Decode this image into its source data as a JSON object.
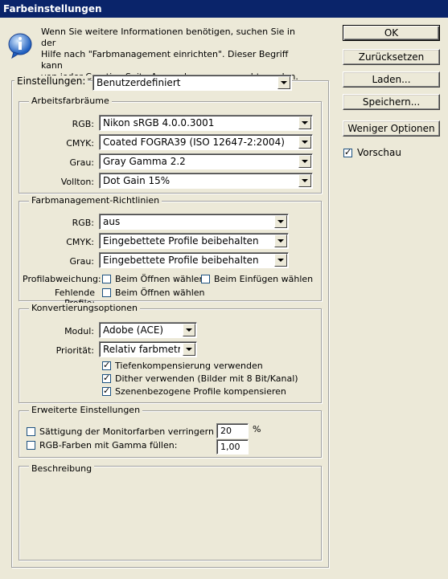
{
  "window": {
    "title": "Farbeinstellungen"
  },
  "info": {
    "text_line1": "Wenn Sie weitere Informationen benötigen, suchen Sie in der",
    "text_line2": "Hilfe nach \"Farbmanagement einrichten\". Dieser Begriff kann",
    "text_line3": "von jeder Creative Suite-Anwendung aus gesucht werden."
  },
  "buttons": {
    "ok": "OK",
    "reset": "Zurücksetzen",
    "load": "Laden...",
    "save": "Speichern...",
    "fewer_options": "Weniger Optionen"
  },
  "preview": {
    "label": "Vorschau",
    "checked": true
  },
  "settings": {
    "label": "Einstellungen:",
    "value": "Benutzerdefiniert"
  },
  "workspaces": {
    "legend": "Arbeitsfarbräume",
    "rgb_label": "RGB:",
    "rgb_value": "Nikon sRGB 4.0.0.3001",
    "cmyk_label": "CMYK:",
    "cmyk_value": "Coated FOGRA39 (ISO 12647-2:2004)",
    "gray_label": "Grau:",
    "gray_value": "Gray Gamma 2.2",
    "spot_label": "Vollton:",
    "spot_value": "Dot Gain 15%"
  },
  "policies": {
    "legend": "Farbmanagement-Richtlinien",
    "rgb_label": "RGB:",
    "rgb_value": "aus",
    "cmyk_label": "CMYK:",
    "cmyk_value": "Eingebettete Profile beibehalten",
    "gray_label": "Grau:",
    "gray_value": "Eingebettete Profile beibehalten",
    "mismatch_label": "Profilabweichung:",
    "mismatch_open": "Beim Öffnen wählen",
    "mismatch_paste": "Beim Einfügen wählen",
    "missing_label": "Fehlende Profile:",
    "missing_open": "Beim Öffnen wählen"
  },
  "conversion": {
    "legend": "Konvertierungsoptionen",
    "engine_label": "Modul:",
    "engine_value": "Adobe (ACE)",
    "intent_label": "Priorität:",
    "intent_value": "Relativ farbmetr...",
    "bpc": "Tiefenkompensierung verwenden",
    "dither": "Dither verwenden (Bilder mit 8 Bit/Kanal)",
    "scene": "Szenenbezogene Profile kompensieren"
  },
  "advanced": {
    "legend": "Erweiterte Einstellungen",
    "desaturate_label": "Sättigung der Monitorfarben verringern um:",
    "desaturate_value": "20",
    "desaturate_unit": "%",
    "blend_label": "RGB-Farben mit Gamma füllen:",
    "blend_value": "1,00"
  },
  "description": {
    "legend": "Beschreibung"
  }
}
